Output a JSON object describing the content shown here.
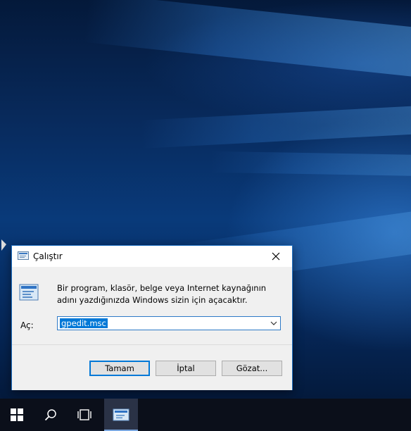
{
  "dialog": {
    "title": "Çalıştır",
    "description": "Bir program, klasör, belge veya Internet kaynağının adını yazdığınızda Windows sizin için açacaktır.",
    "open_label": "Aç:",
    "command_value": "gpedit.msc",
    "buttons": {
      "ok": "Tamam",
      "cancel": "İptal",
      "browse": "Gözat..."
    }
  },
  "taskbar": {
    "items": [
      {
        "name": "start-button",
        "icon": "windows-logo-icon"
      },
      {
        "name": "search-button",
        "icon": "search-icon"
      },
      {
        "name": "task-view-button",
        "icon": "task-view-icon"
      },
      {
        "name": "run-taskbar-item",
        "icon": "run-icon",
        "active": true
      }
    ]
  }
}
